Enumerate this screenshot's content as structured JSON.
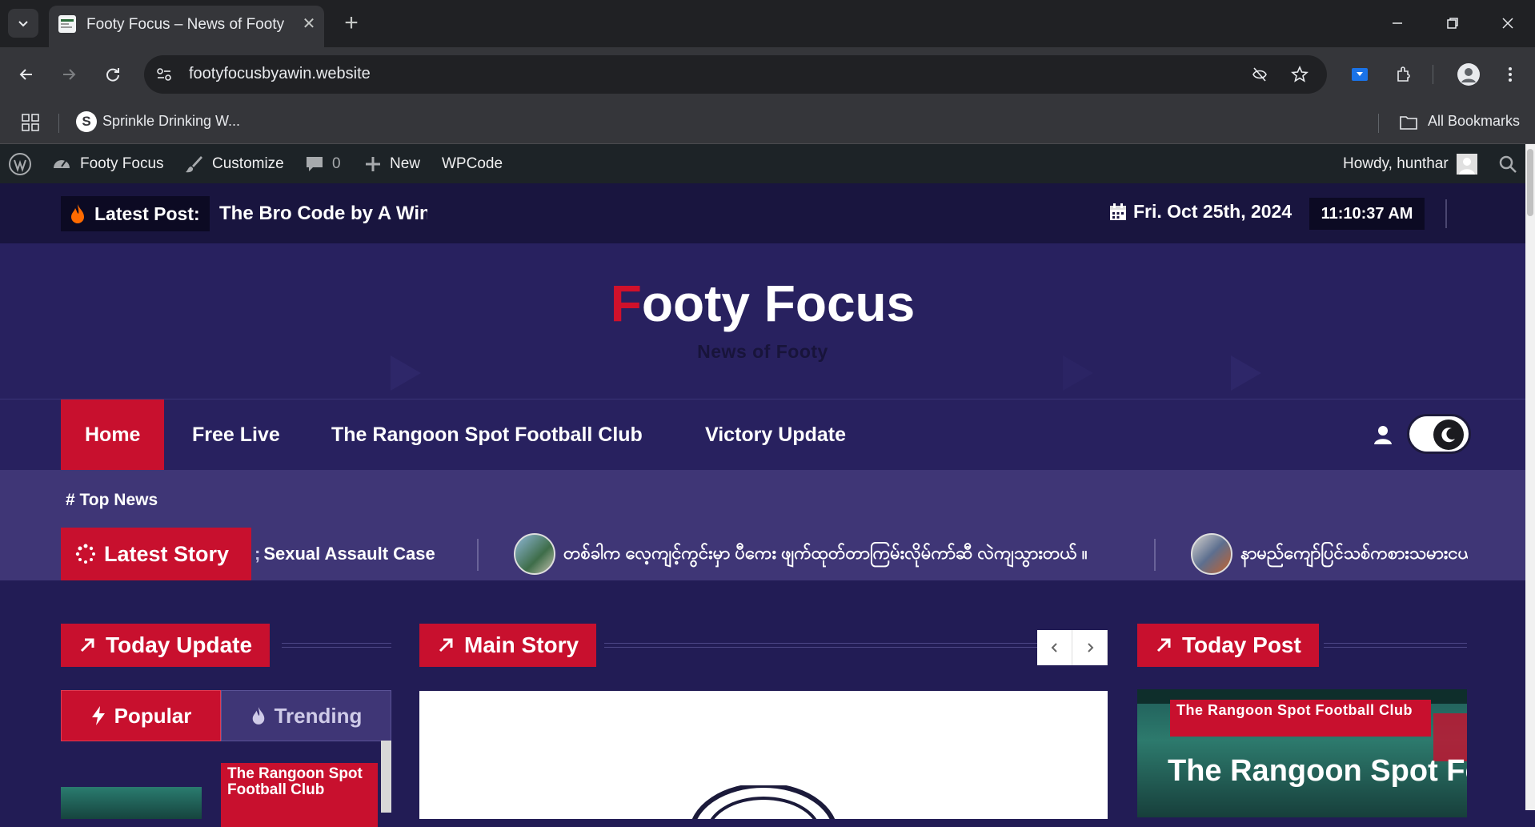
{
  "browser": {
    "tab_title": "Footy Focus – News of Footy",
    "url": "footyfocusbyawin.website",
    "bookmark_1": "Sprinkle Drinking W...",
    "all_bookmarks": "All Bookmarks"
  },
  "wpbar": {
    "site_name": "Footy Focus",
    "customize": "Customize",
    "comments_count": "0",
    "new": "New",
    "wpcode": "WPCode",
    "howdy": "Howdy, hunthar"
  },
  "topstrip": {
    "latest_label": "Latest Post:",
    "latest_text": "The Bro Code by A Win",
    "date": "Fri. Oct 25th, 2024",
    "time": "11:10:37 AM"
  },
  "header": {
    "title_first": "F",
    "title_rest": "ooty Focus",
    "tagline": "News of Footy"
  },
  "nav": {
    "items": [
      "Home",
      "Free Live",
      "The Rangoon Spot Football Club",
      "Victory Update"
    ],
    "active": "Home"
  },
  "topnews": {
    "label": "# Top News",
    "badge": "Latest Story",
    "ticker": [
      "Sexual Assault Case",
      "တစ်ခါက လေ့ကျင့်ကွင်းမှာ ပီကေး ဖျက်ထုတ်တာကြမ်းလိုမ်ကာ်ဆီ လဲကျသွားတယ် ။",
      "နာမည်ကျော်ပြင်သစ်ကစားသမားငယ"
    ]
  },
  "sections": {
    "today_update": "Today Update",
    "main_story": "Main Story",
    "today_post": "Today Post",
    "tab_popular": "Popular",
    "tab_trending": "Trending",
    "popular_cat": "The Rangoon Spot Football Club",
    "post_cat": "The Rangoon Spot Football Club",
    "post_title": "The Rangoon Spot Football"
  },
  "colors": {
    "accent": "#c8102e",
    "header_bg": "#28215f",
    "topnews_bg": "#3f3676",
    "strip_bg": "#19153f"
  }
}
